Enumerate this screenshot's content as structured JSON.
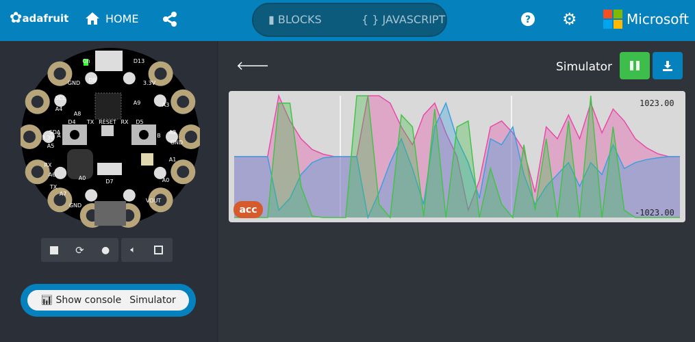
{
  "header": {
    "logo": "adafruit",
    "home": "HOME",
    "blocks": "BLOCKS",
    "javascript": "{ } JAVASCRIPT",
    "brand": "Microsoft",
    "icons": [
      "home-icon",
      "share-icon",
      "puzzle-icon",
      "help-icon",
      "gear-icon"
    ]
  },
  "board": {
    "labels": [
      "On",
      "D13",
      "GND",
      "D8",
      "SCL",
      "A4",
      "SDA",
      "A5",
      "3.3V",
      "RX",
      "A6",
      "TX",
      "A7",
      "GND",
      "3.3V",
      "A3",
      "A2",
      "GND",
      "A1",
      "A0",
      "VOUT",
      "A9",
      "A8",
      "D4",
      "D5",
      "TX",
      "RESET",
      "RX",
      "A",
      "B",
      "D7",
      "A0"
    ]
  },
  "controls": {
    "icons": [
      "stop-icon",
      "restart-icon",
      "slow-mo-icon",
      "mute-icon",
      "fullscreen-icon"
    ]
  },
  "console": {
    "show": "Show console",
    "sim": "Simulator"
  },
  "console_view": {
    "title": "Simulator",
    "tag": "acc",
    "max": "1023.00",
    "min": "-1023.00"
  },
  "colors": {
    "header": "#0582bd",
    "pause": "#3dbd4a",
    "download": "#0582bd",
    "acc_tag": "#d55a2c"
  },
  "chart_data": {
    "type": "area",
    "ylim": [
      -1023,
      1023
    ],
    "series": [
      {
        "color": "#e84aa8",
        "values": [
          0,
          0,
          0,
          0,
          1023,
          600,
          300,
          120,
          40,
          0,
          0,
          0,
          1023,
          1023,
          900,
          500,
          200,
          700,
          900,
          400,
          0,
          -900,
          -400,
          500,
          600,
          400,
          100,
          -600,
          500,
          300,
          700,
          300,
          900,
          400,
          800,
          600,
          300,
          150,
          50,
          0,
          0
        ]
      },
      {
        "color": "#3aa0dc",
        "values": [
          0,
          0,
          0,
          0,
          -900,
          -700,
          -300,
          -100,
          -20,
          0,
          0,
          0,
          -1023,
          -600,
          -100,
          300,
          -200,
          -800,
          500,
          900,
          300,
          -100,
          -700,
          300,
          200,
          500,
          -300,
          -800,
          -500,
          -300,
          -100,
          -500,
          -100,
          -300,
          200,
          -200,
          -100,
          -50,
          -20,
          0,
          0
        ]
      },
      {
        "color": "#45c14a",
        "values": [
          -1023,
          -1023,
          -1023,
          -1023,
          900,
          900,
          -500,
          -1000,
          -1023,
          -1023,
          -1023,
          1023,
          1023,
          -800,
          -1023,
          700,
          500,
          -1000,
          800,
          -1023,
          500,
          600,
          -1023,
          -200,
          -800,
          -1023,
          200,
          -900,
          300,
          -1023,
          600,
          -1023,
          1023,
          -1023,
          500,
          -900,
          -1023,
          -1023,
          -1023,
          -1023,
          -1023
        ]
      }
    ]
  }
}
